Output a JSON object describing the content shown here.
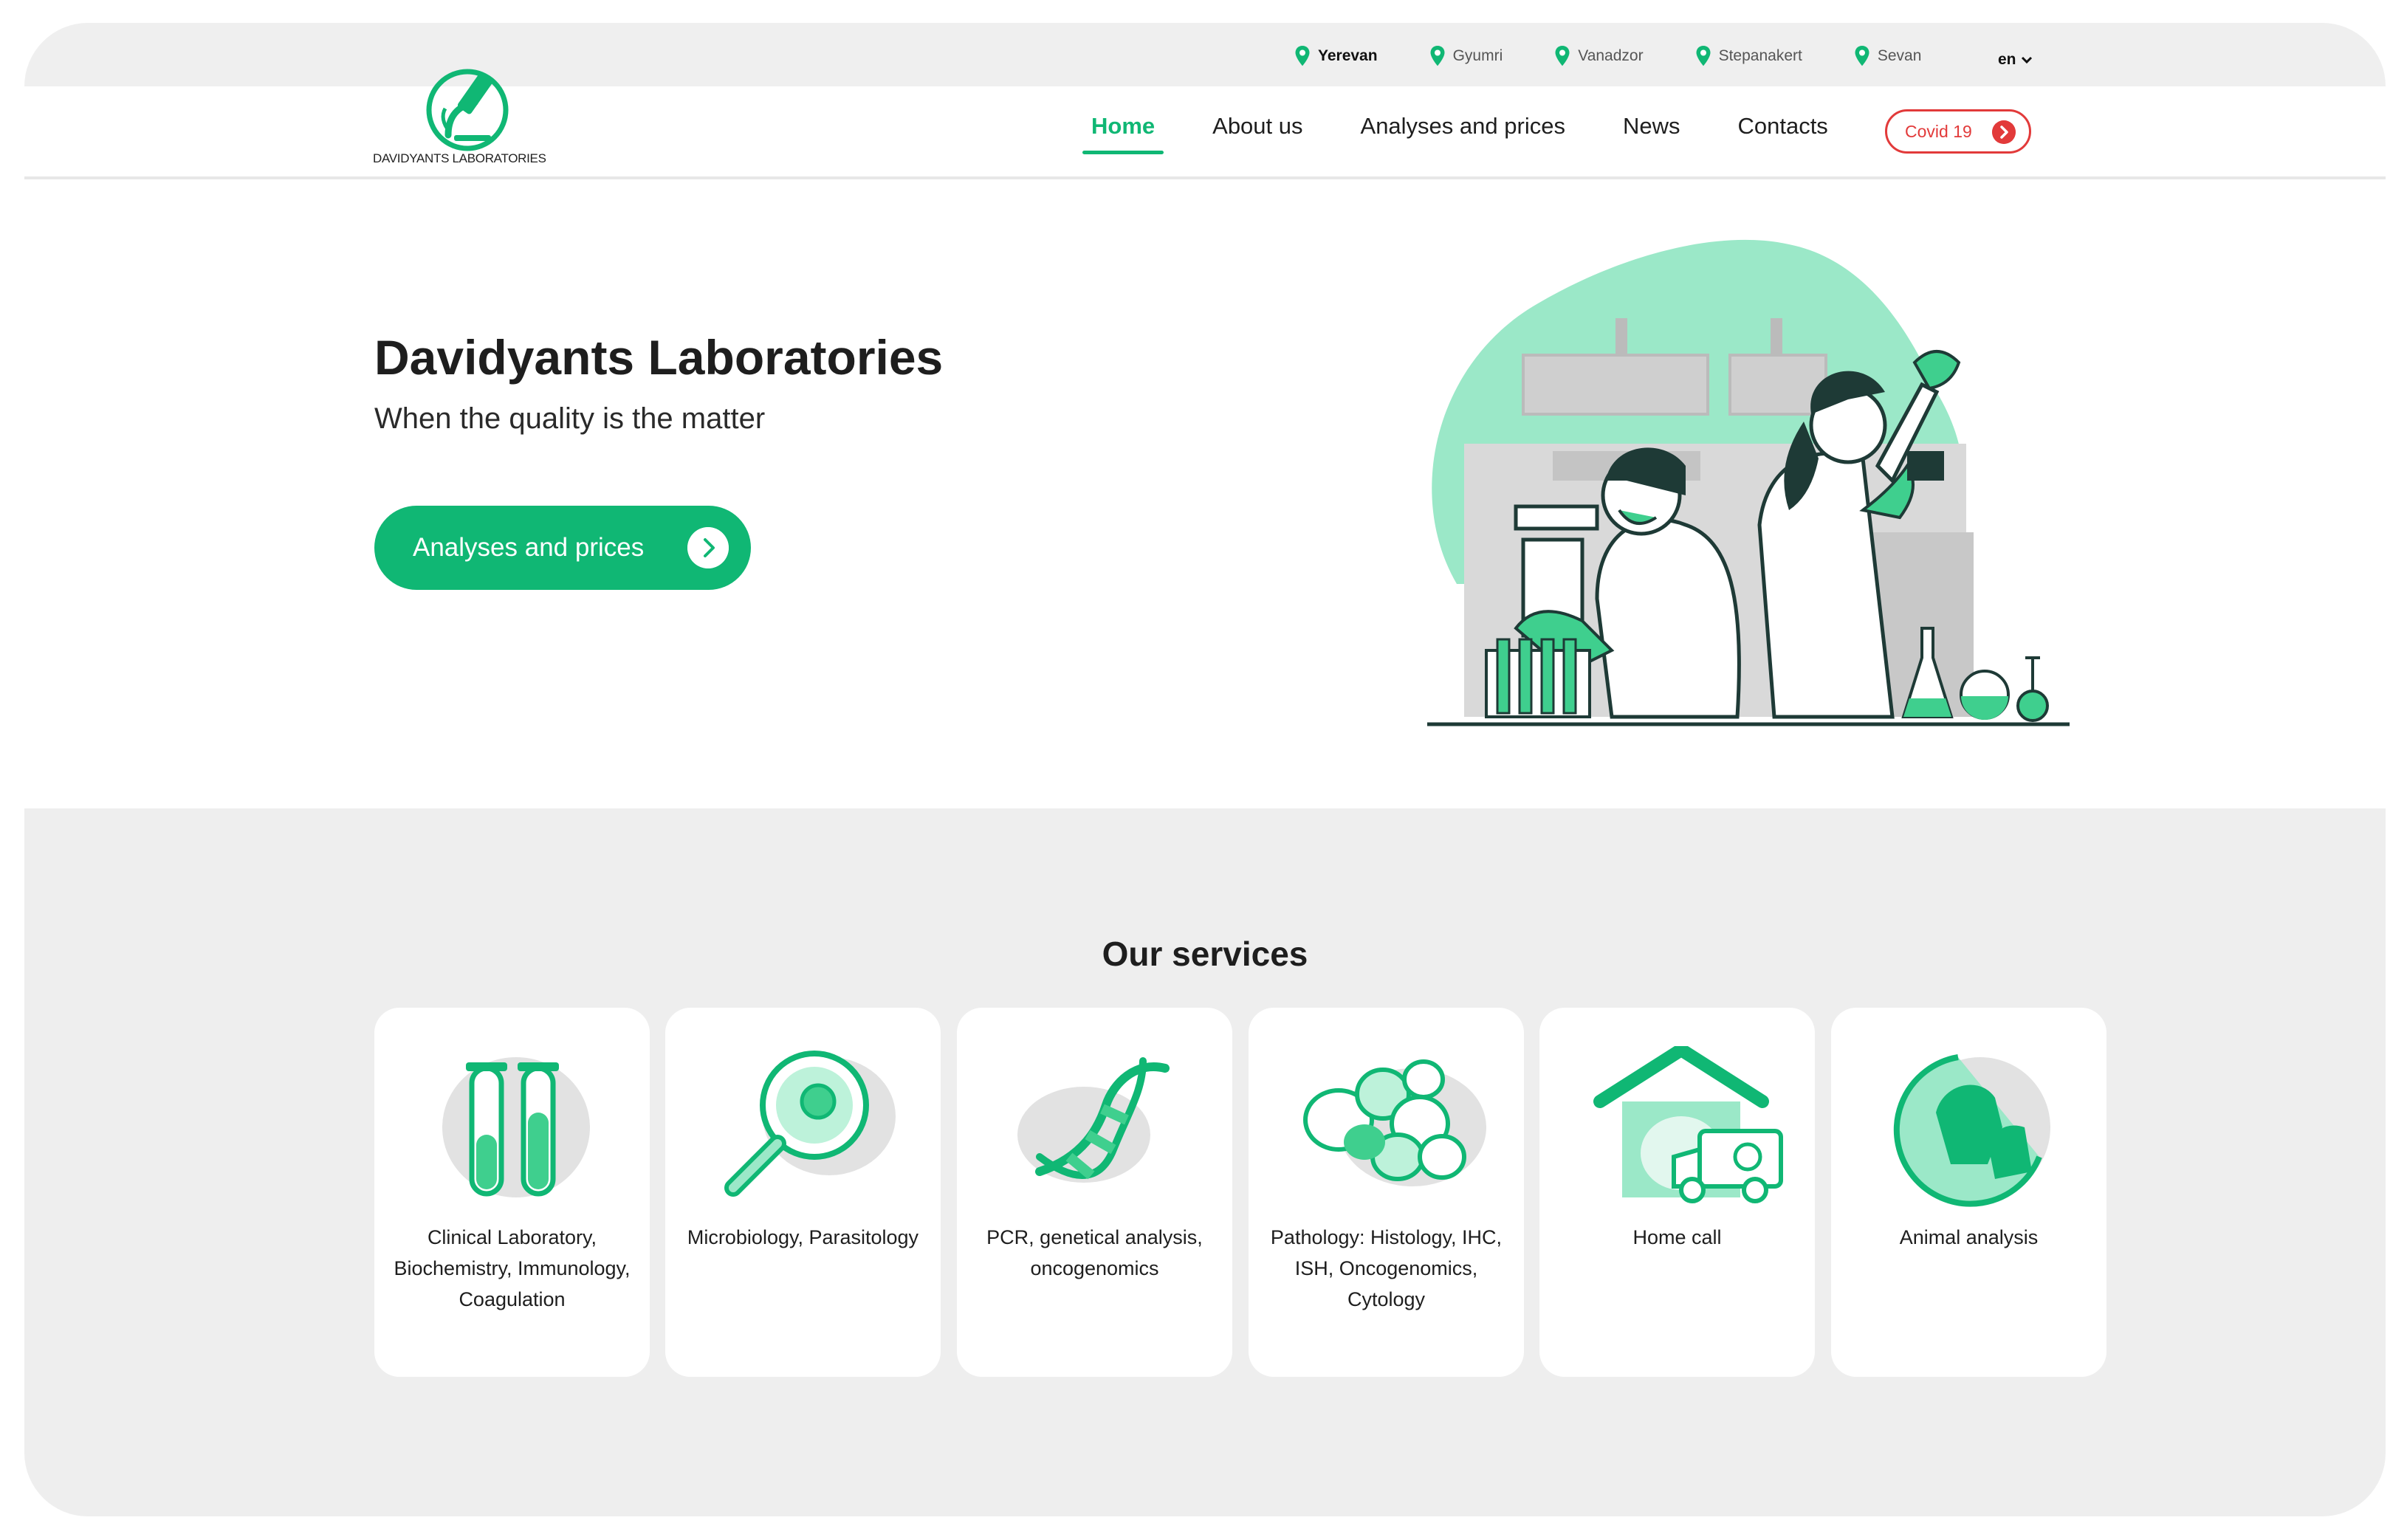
{
  "brand": {
    "name": "DAVIDYANTS LABORATORIES",
    "accent": "#10b774",
    "alert": "#e23a3a"
  },
  "topbar": {
    "cities": [
      "Yerevan",
      "Gyumri",
      "Vanadzor",
      "Stepanakert",
      "Sevan"
    ],
    "active_city": "Yerevan",
    "language": "en"
  },
  "nav": {
    "items": [
      "Home",
      "About us",
      "Analyses and prices",
      "News",
      "Contacts"
    ],
    "active": "Home",
    "covid_label": "Covid 19"
  },
  "hero": {
    "title": "Davidyants Laboratories",
    "subtitle": "When the quality is the matter",
    "button_label": "Analyses and prices"
  },
  "services": {
    "title": "Our services",
    "items": [
      {
        "label": "Clinical Laboratory, Biochemistry, Immunology, Coagulation",
        "icon": "test-tubes-icon"
      },
      {
        "label": "Microbiology, Parasitology",
        "icon": "magnifier-microbe-icon"
      },
      {
        "label": "PCR, genetical analysis, oncogenomics",
        "icon": "dna-icon"
      },
      {
        "label": "Pathology: Histology, IHC, ISH, Oncogenomics, Cytology",
        "icon": "cells-icon"
      },
      {
        "label": "Home call",
        "icon": "house-ambulance-icon"
      },
      {
        "label": "Animal analysis",
        "icon": "animals-icon"
      }
    ]
  }
}
